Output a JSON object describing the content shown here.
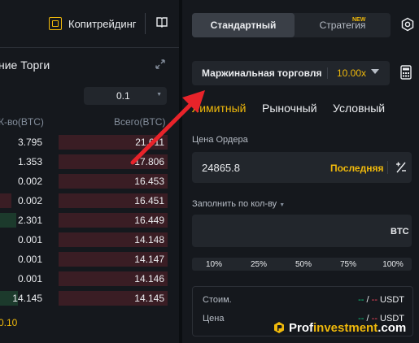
{
  "header": {
    "copytrading_label": "Копитрейдинг"
  },
  "orderbook": {
    "title": "ние Торги",
    "tick_size": "0.1",
    "col_qty": "К-во(BTC)",
    "col_total": "Всего(BTC)",
    "rows": [
      {
        "qty": "3.795",
        "total": "21.611"
      },
      {
        "qty": "1.353",
        "total": "17.806"
      },
      {
        "qty": "0.002",
        "total": "16.453"
      },
      {
        "qty": "0.002",
        "total": "16.451"
      },
      {
        "qty": "2.301",
        "total": "16.449"
      },
      {
        "qty": "0.001",
        "total": "14.148"
      },
      {
        "qty": "0.001",
        "total": "14.147"
      },
      {
        "qty": "0.001",
        "total": "14.146"
      },
      {
        "qty": "14.145",
        "total": "14.145"
      }
    ],
    "bottom_value": "0.10"
  },
  "trade_panel": {
    "tabs": {
      "standard": "Стандартный",
      "strategy": "Стратегия",
      "strategy_badge": "NEW"
    },
    "margin": {
      "label": "Маржинальная торговля",
      "leverage": "10.00x"
    },
    "order_types": {
      "limit": "Лимитный",
      "market": "Рыночный",
      "conditional": "Условный"
    },
    "price": {
      "label": "Цена Ордера",
      "value": "24865.8",
      "last_label": "Последняя"
    },
    "amount": {
      "label": "Заполнить по кол-ву",
      "unit": "BTC"
    },
    "percentages": [
      "10%",
      "25%",
      "50%",
      "75%",
      "100%"
    ],
    "summary": {
      "cost_label": "Стоим.",
      "cost_left": "--",
      "cost_sep": "/",
      "cost_right": "--",
      "cost_unit": "USDT",
      "price_label": "Цена",
      "price_left": "--",
      "price_sep": "/",
      "price_right": "--",
      "price_unit": "USDT"
    }
  },
  "watermark": {
    "part1": "Prof",
    "part2": "investment",
    "part3": ".com"
  },
  "colors": {
    "accent": "#f0b90b",
    "sell": "#f6465d",
    "buy": "#0ecb81",
    "arrow": "#e8232a"
  }
}
